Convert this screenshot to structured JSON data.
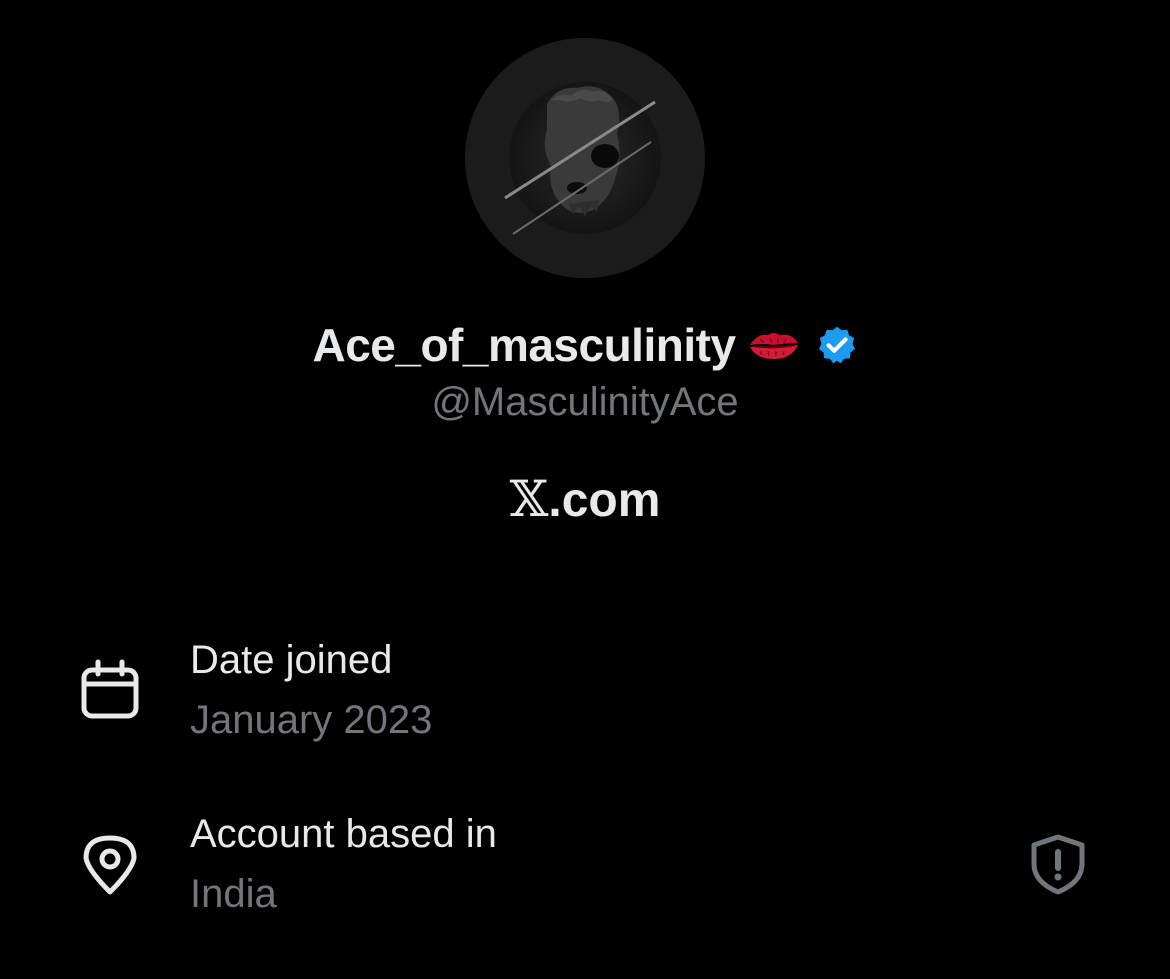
{
  "profile": {
    "display_name": "Ace_of_masculinity",
    "name_emoji_icon": "kiss-mark-icon",
    "verified_icon": "verified-badge-icon",
    "handle": "@MasculinityAce",
    "site_prefix": "𝕏",
    "site_suffix": ".com"
  },
  "about": {
    "items": [
      {
        "icon": "calendar-icon",
        "label": "Date joined",
        "value": "January 2023"
      },
      {
        "icon": "location-pin-icon",
        "label": "Account based in",
        "value": "India",
        "trailing_icon": "shield-alert-icon"
      }
    ]
  },
  "colors": {
    "background": "#000000",
    "primary_text": "#e7e9ea",
    "secondary_text": "#71767b",
    "verified_blue": "#1d9bf0",
    "lips_red": "#c8102e"
  }
}
